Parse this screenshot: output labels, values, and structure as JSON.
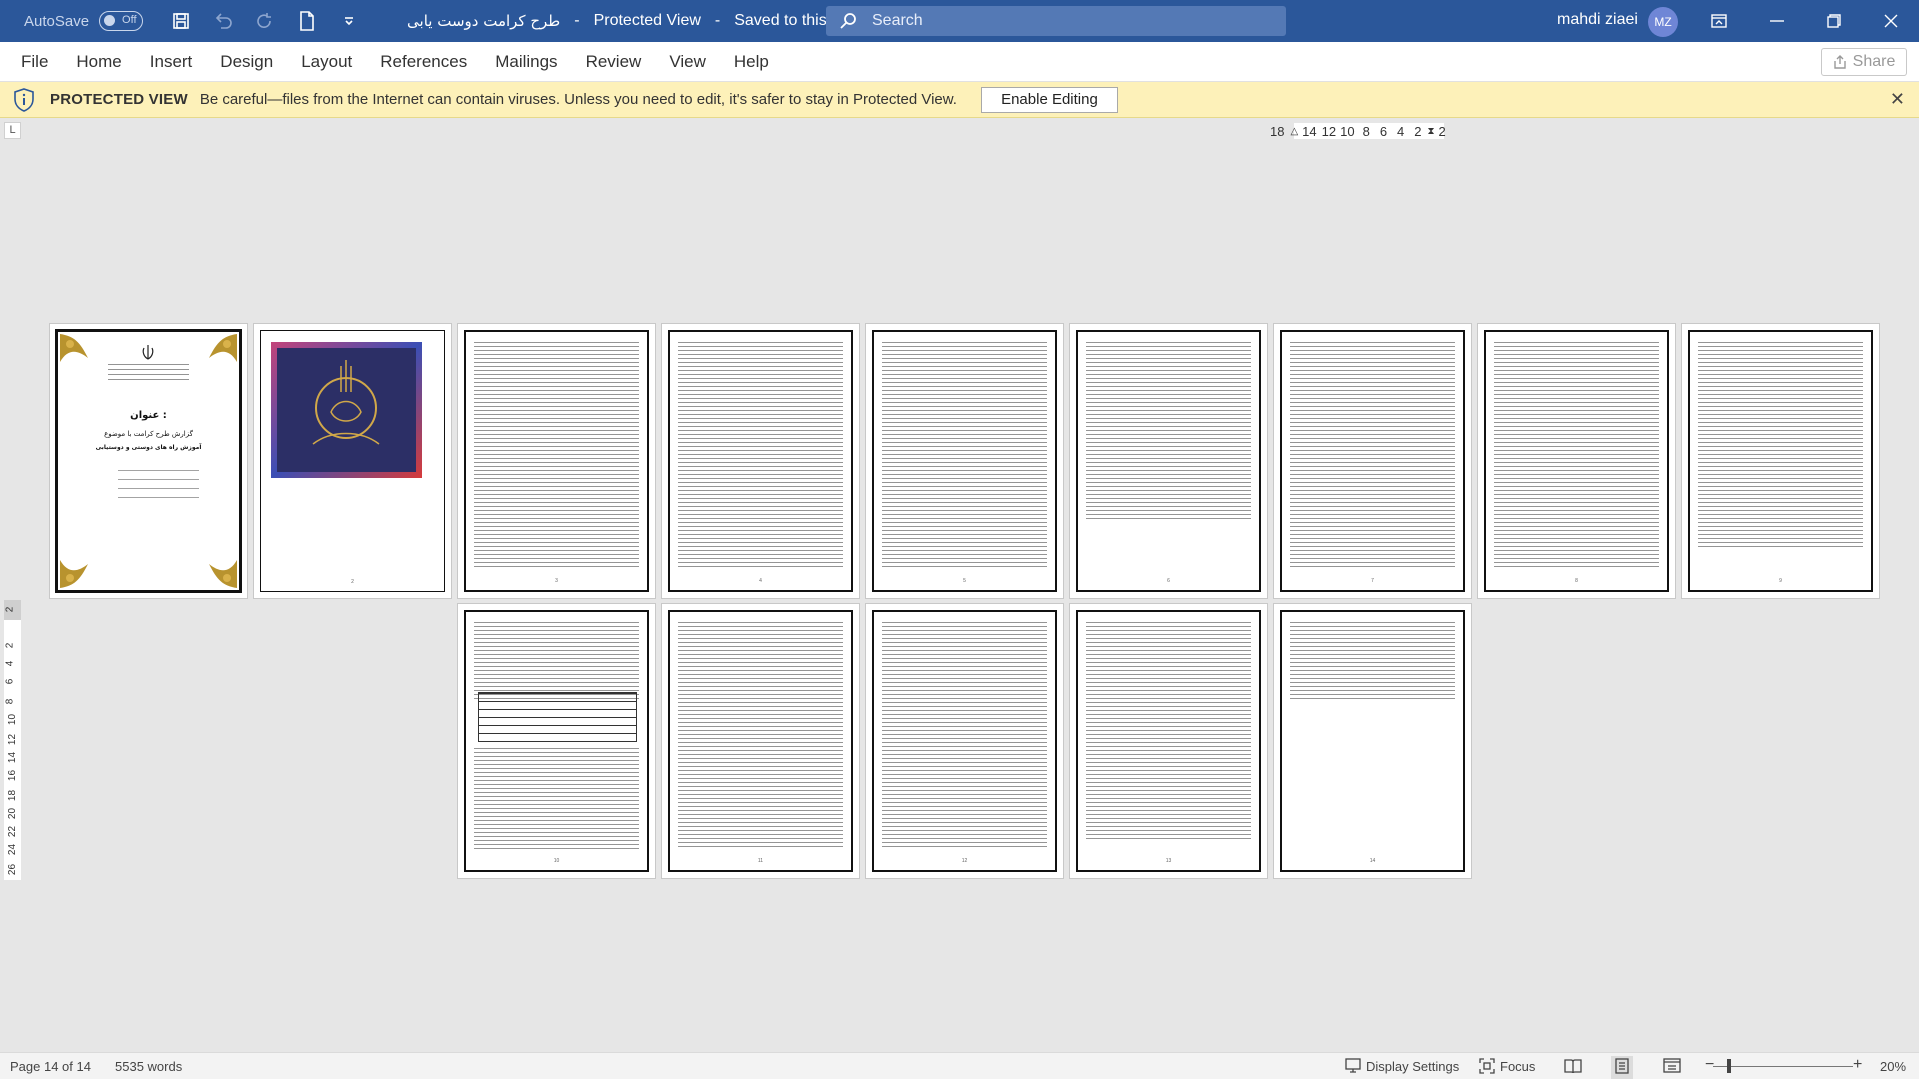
{
  "titlebar": {
    "autosave_label": "AutoSave",
    "autosave_state": "Off",
    "doc_title": "طرح کرامت دوست یابی",
    "doc_mode": "Protected View",
    "doc_saved": "Saved to this PC",
    "search_placeholder": "Search",
    "user_name": "mahdi ziaei",
    "user_initials": "MZ"
  },
  "ribbon": {
    "tabs": [
      "File",
      "Home",
      "Insert",
      "Design",
      "Layout",
      "References",
      "Mailings",
      "Review",
      "View",
      "Help"
    ],
    "share_label": "Share"
  },
  "protected_view": {
    "title": "PROTECTED VIEW",
    "message": "Be careful—files from the Internet can contain viruses. Unless you need to edit, it's safer to stay in Protected View.",
    "enable_label": "Enable Editing"
  },
  "ruler": {
    "corner": "L",
    "h_ticks": [
      "18",
      "14",
      "12",
      "10",
      "8",
      "6",
      "4",
      "2",
      "2"
    ],
    "v_ticks": [
      "2",
      "2",
      "4",
      "6",
      "8",
      "10",
      "12",
      "14",
      "16",
      "18",
      "20",
      "22",
      "24",
      "26"
    ]
  },
  "cover": {
    "title": "عنوان :",
    "subtitle": "گزارش طرح کرامت با موضوع",
    "subtitle2": "آموزش راه های دوستی و دوستیابی"
  },
  "status": {
    "page": "Page 14 of 14",
    "words": "5535 words",
    "display_settings": "Display Settings",
    "focus": "Focus",
    "zoom": "20%"
  },
  "colors": {
    "titlebar": "#2b579a",
    "protected_bar": "#fdf1b9"
  }
}
